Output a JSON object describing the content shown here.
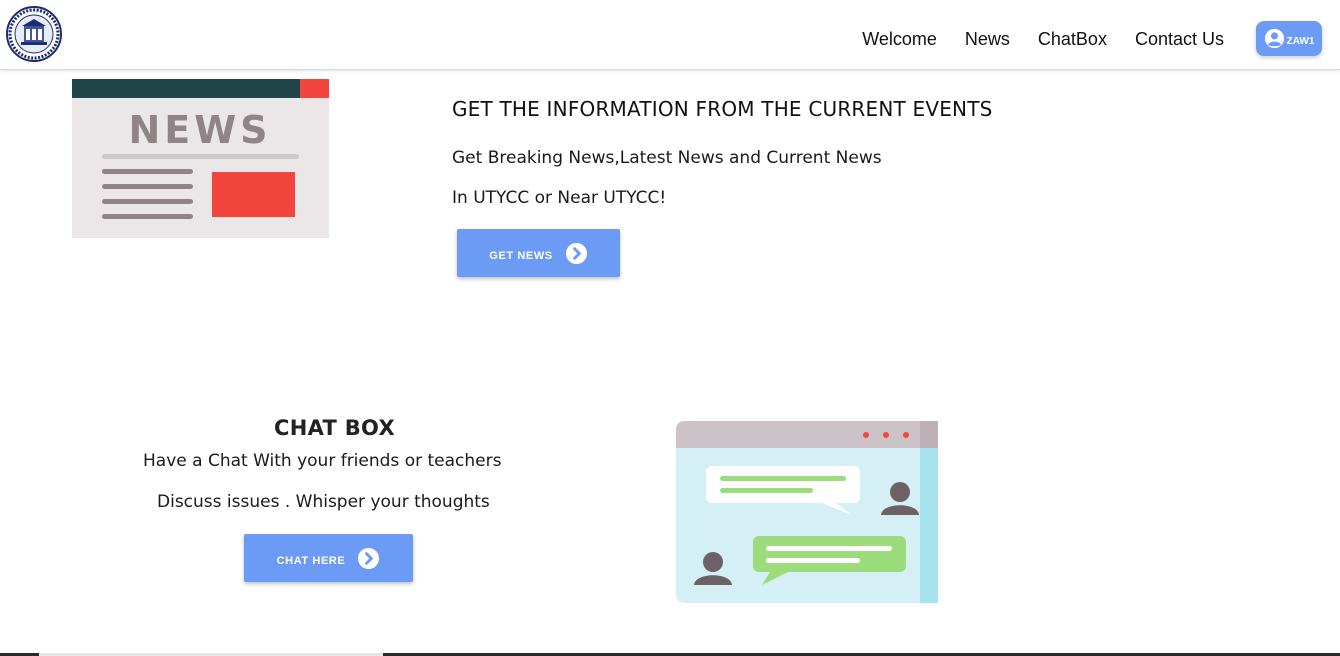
{
  "header": {
    "logo_name": "college-seal",
    "nav": [
      "Welcome",
      "News",
      "ChatBox",
      "Contact Us"
    ],
    "user": {
      "name": "ZAW1",
      "icon": "user-circle-icon"
    }
  },
  "news_section": {
    "heading": "GET THE INFORMATION FROM THE CURRENT EVENTS",
    "line1": "Get Breaking News,Latest News and Current News",
    "line2": "In UTYCC or Near UTYCC!",
    "button_label": "GET NEWS",
    "illustration_word": "NEWS"
  },
  "chat_section": {
    "title": "CHAT BOX",
    "line1": "Have a Chat With your friends or teachers",
    "line2": "Discuss issues . Whisper your thoughts",
    "button_label": "CHAT HERE"
  },
  "colors": {
    "accent": "#6b9bf5",
    "news_red": "#f2453d",
    "news_dark": "#1f4549",
    "chat_green": "#9cdc7d",
    "chat_blue": "#d5f0f5"
  }
}
